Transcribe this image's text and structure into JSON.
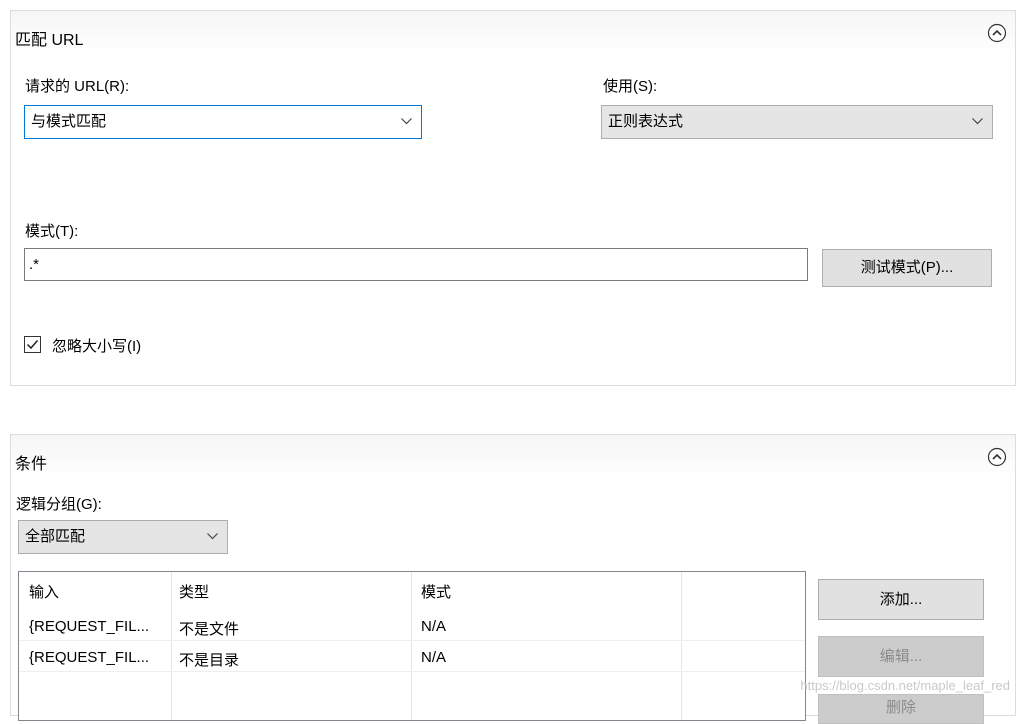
{
  "match_url": {
    "title": "匹配 URL",
    "requested_url_label": "请求的 URL(R):",
    "requested_url_value": "与模式匹配",
    "using_label": "使用(S):",
    "using_value": "正则表达式",
    "pattern_label": "模式(T):",
    "pattern_value": ".*",
    "test_pattern_button": "测试模式(P)...",
    "ignore_case_label": "忽略大小写(I)",
    "ignore_case_checked": true
  },
  "conditions": {
    "title": "条件",
    "logical_grouping_label": "逻辑分组(G):",
    "logical_grouping_value": "全部匹配",
    "table": {
      "columns": [
        "输入",
        "类型",
        "模式"
      ],
      "rows": [
        [
          "{REQUEST_FIL...",
          "不是文件",
          "N/A"
        ],
        [
          "{REQUEST_FIL...",
          "不是目录",
          "N/A"
        ]
      ]
    },
    "add_button": "添加...",
    "edit_button": "编辑...",
    "remove_button": "删除"
  },
  "watermark": "https://blog.csdn.net/maple_leaf_red",
  "colors": {
    "focus_border": "#0078d7",
    "button_bg": "#e1e1e1",
    "disabled_bg": "#cccccc"
  }
}
